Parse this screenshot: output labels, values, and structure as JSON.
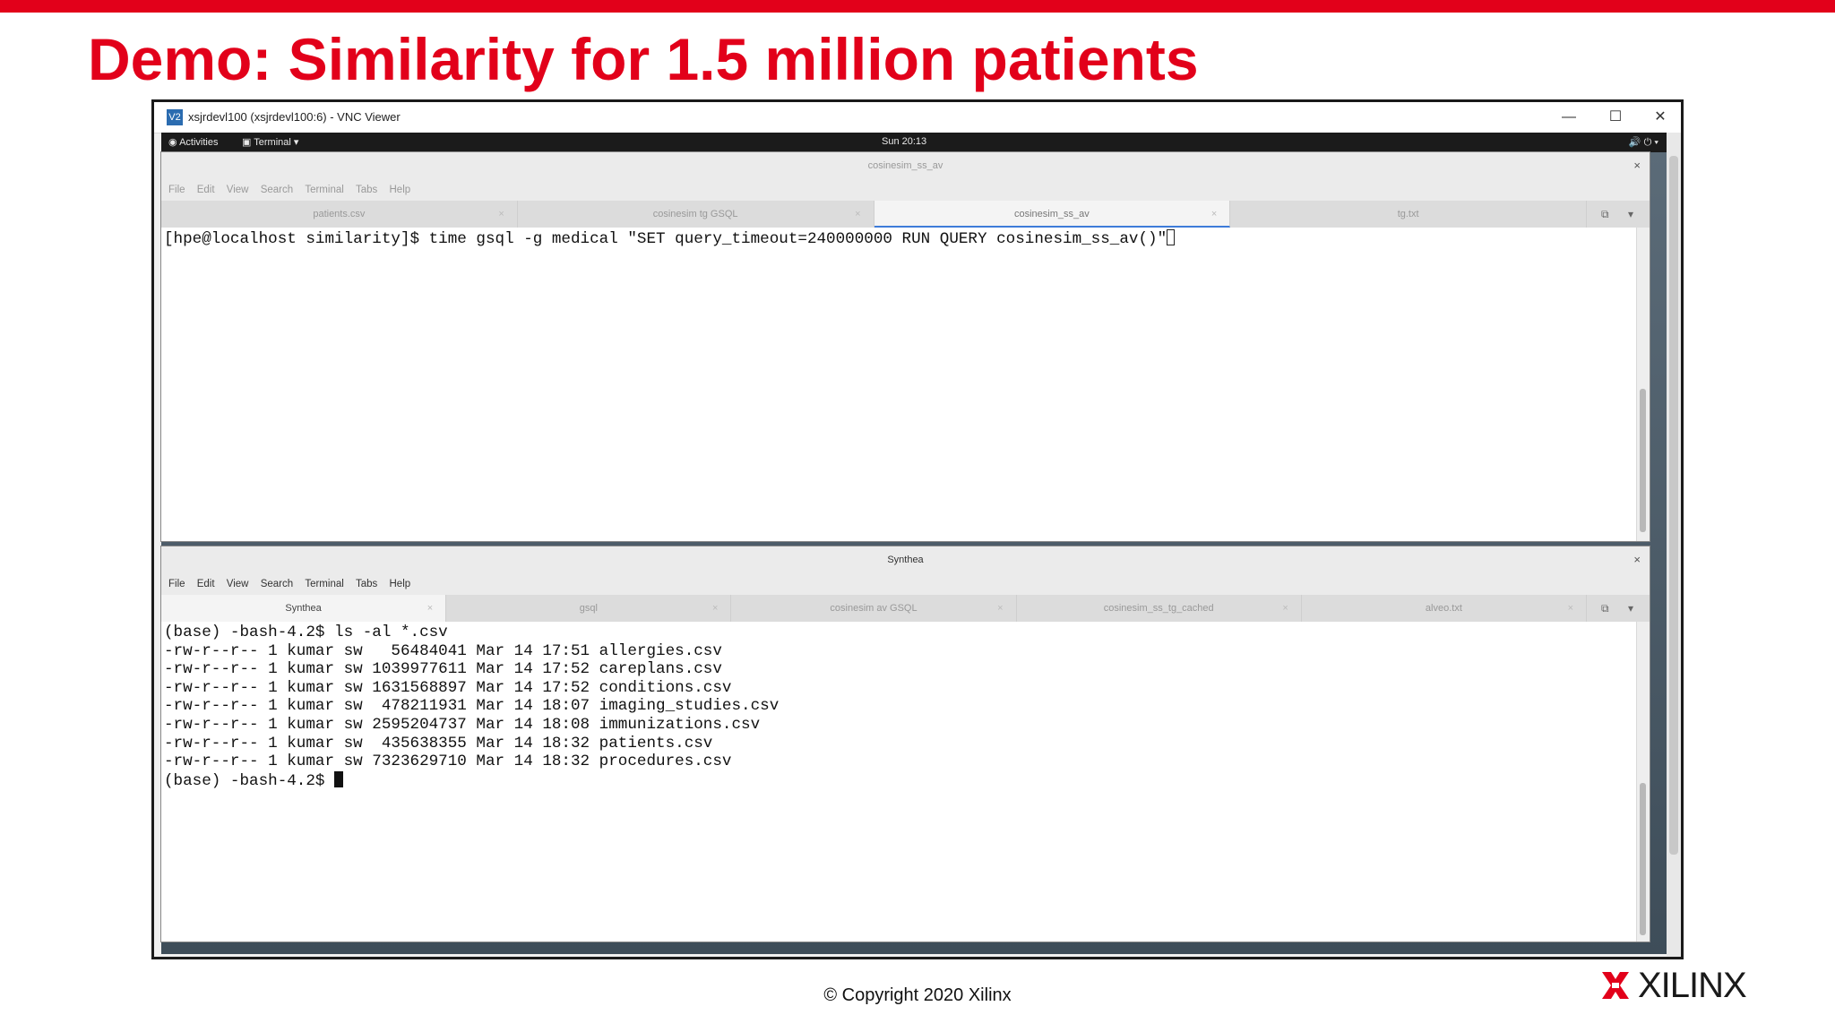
{
  "slide": {
    "title": "Demo: Similarity for 1.5 million patients",
    "copyright": "© Copyright 2020 Xilinx",
    "logo_text": "XILINX",
    "accent_color": "#e2001a"
  },
  "vnc": {
    "icon_text": "V2",
    "title": "xsjrdevl100 (xsjrdevl100:6) - VNC Viewer",
    "minimize": "—",
    "maximize": "☐",
    "close": "✕"
  },
  "gnome_bar": {
    "activities": "Activities",
    "app_menu": "Terminal ▾",
    "clock": "Sun 20:13",
    "status_icons": "🔊 ⏻ ▾"
  },
  "terminal_top": {
    "title": "cosinesim_ss_av",
    "menu": [
      "File",
      "Edit",
      "View",
      "Search",
      "Terminal",
      "Tabs",
      "Help"
    ],
    "tabs": [
      "patients.csv",
      "cosinesim tg GSQL",
      "cosinesim_ss_av",
      "tg.txt"
    ],
    "prompt": "[hpe@localhost similarity]$ ",
    "command": "time gsql -g medical \"SET query_timeout=240000000 RUN QUERY cosinesim_ss_av()\""
  },
  "terminal_bottom": {
    "title": "Synthea",
    "menu": [
      "File",
      "Edit",
      "View",
      "Search",
      "Terminal",
      "Tabs",
      "Help"
    ],
    "tabs": [
      "Synthea",
      "gsql",
      "cosinesim av GSQL",
      "cosinesim_ss_tg_cached",
      "alveo.txt"
    ],
    "command_line": "(base) -bash-4.2$ ls -al *.csv",
    "listing": [
      "-rw-r--r-- 1 kumar sw   56484041 Mar 14 17:51 allergies.csv",
      "-rw-r--r-- 1 kumar sw 1039977611 Mar 14 17:52 careplans.csv",
      "-rw-r--r-- 1 kumar sw 1631568897 Mar 14 17:52 conditions.csv",
      "-rw-r--r-- 1 kumar sw  478211931 Mar 14 18:07 imaging_studies.csv",
      "-rw-r--r-- 1 kumar sw 2595204737 Mar 14 18:08 immunizations.csv",
      "-rw-r--r-- 1 kumar sw  435638355 Mar 14 18:32 patients.csv",
      "-rw-r--r-- 1 kumar sw 7323629710 Mar 14 18:32 procedures.csv"
    ],
    "final_prompt": "(base) -bash-4.2$ "
  }
}
